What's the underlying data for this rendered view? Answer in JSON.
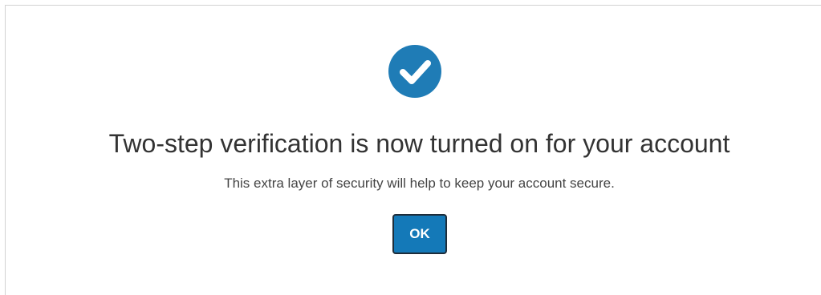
{
  "dialog": {
    "icon": "check-circle-icon",
    "title": "Two-step verification is now turned on for your account",
    "message": "This extra layer of security will help to keep your account secure.",
    "ok_label": "OK"
  },
  "colors": {
    "accent": "#1f7cb6",
    "button_bg": "#1479b8",
    "button_border": "#1e2d3a",
    "title_text": "#333333",
    "body_text": "#444444"
  }
}
